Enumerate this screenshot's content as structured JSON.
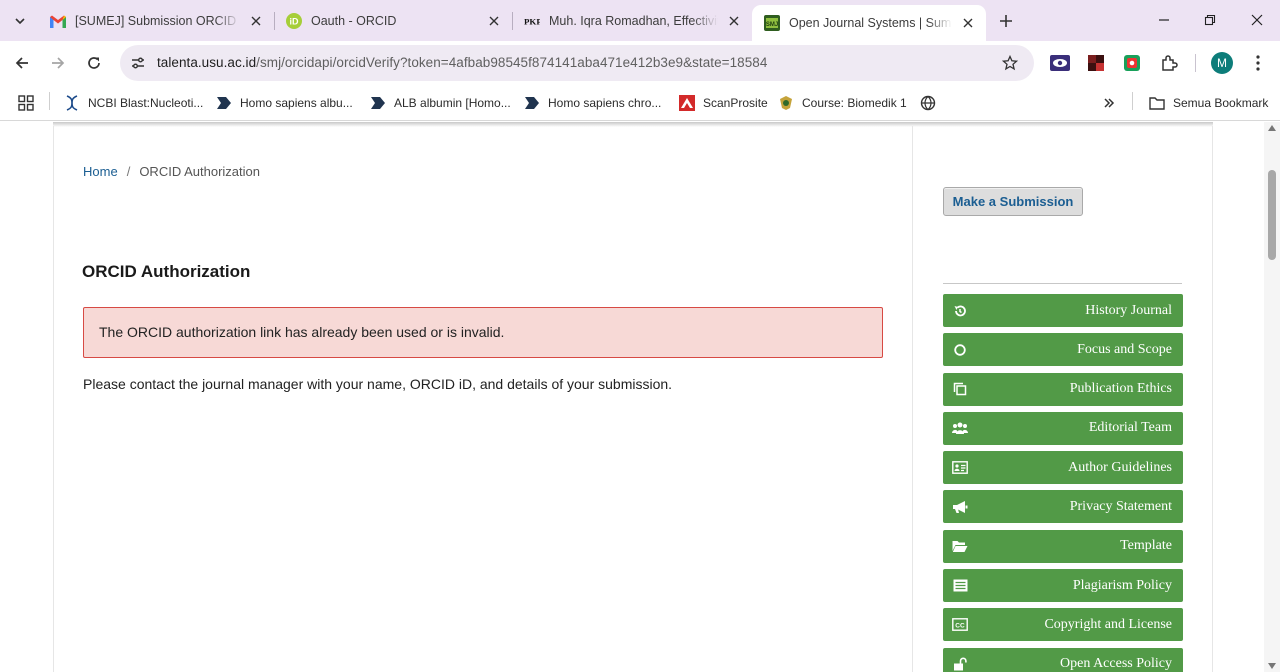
{
  "browser": {
    "tabs": [
      {
        "title": "[SUMEJ] Submission ORCID - iq",
        "favicon": "gmail-icon"
      },
      {
        "title": "Oauth - ORCID",
        "favicon": "orcid-icon"
      },
      {
        "title": "Muh. Iqra Romadhan, Effectivity",
        "favicon": "pkp-icon"
      },
      {
        "title": "Open Journal Systems | Sumate",
        "favicon": "smj-icon",
        "active": true
      }
    ],
    "url_host": "talenta.usu.ac.id",
    "url_path": "/smj/orcidapi/orcidVerify?token=4afbab98545f874141aba471e412b3e9&state=18584",
    "profile_initial": "M",
    "bookmarks": [
      "NCBI Blast:Nucleoti...",
      "Homo sapiens albu...",
      "ALB albumin [Homo...",
      "Homo sapiens chro...",
      "ScanProsite",
      "Course: Biomedik 1"
    ],
    "all_bookmarks_label": "Semua Bookmark"
  },
  "page": {
    "breadcrumb_home": "Home",
    "breadcrumb_sep": "/",
    "breadcrumb_current": "ORCID Authorization",
    "title": "ORCID Authorization",
    "alert": "The ORCID authorization link has already been used or is invalid.",
    "description": "Please contact the journal manager with your name, ORCID iD, and details of your submission."
  },
  "sidebar": {
    "submit_label": "Make a Submission",
    "items": [
      {
        "label": "History Journal",
        "icon": "history-icon"
      },
      {
        "label": "Focus and Scope",
        "icon": "circle-icon"
      },
      {
        "label": "Publication Ethics",
        "icon": "copy-icon"
      },
      {
        "label": "Editorial Team",
        "icon": "users-icon"
      },
      {
        "label": "Author Guidelines",
        "icon": "id-card-icon"
      },
      {
        "label": "Privacy Statement",
        "icon": "bullhorn-icon"
      },
      {
        "label": "Template",
        "icon": "folder-open-icon"
      },
      {
        "label": "Plagiarism Policy",
        "icon": "list-icon"
      },
      {
        "label": "Copyright and License",
        "icon": "cc-icon"
      },
      {
        "label": "Open Access Policy",
        "icon": "unlock-icon"
      }
    ]
  },
  "colors": {
    "sidebar_button": "#529a47",
    "alert_bg": "#f7d9d6",
    "alert_border": "#d74a44",
    "link": "#1b5e92",
    "tabstrip": "#ede3f3"
  }
}
